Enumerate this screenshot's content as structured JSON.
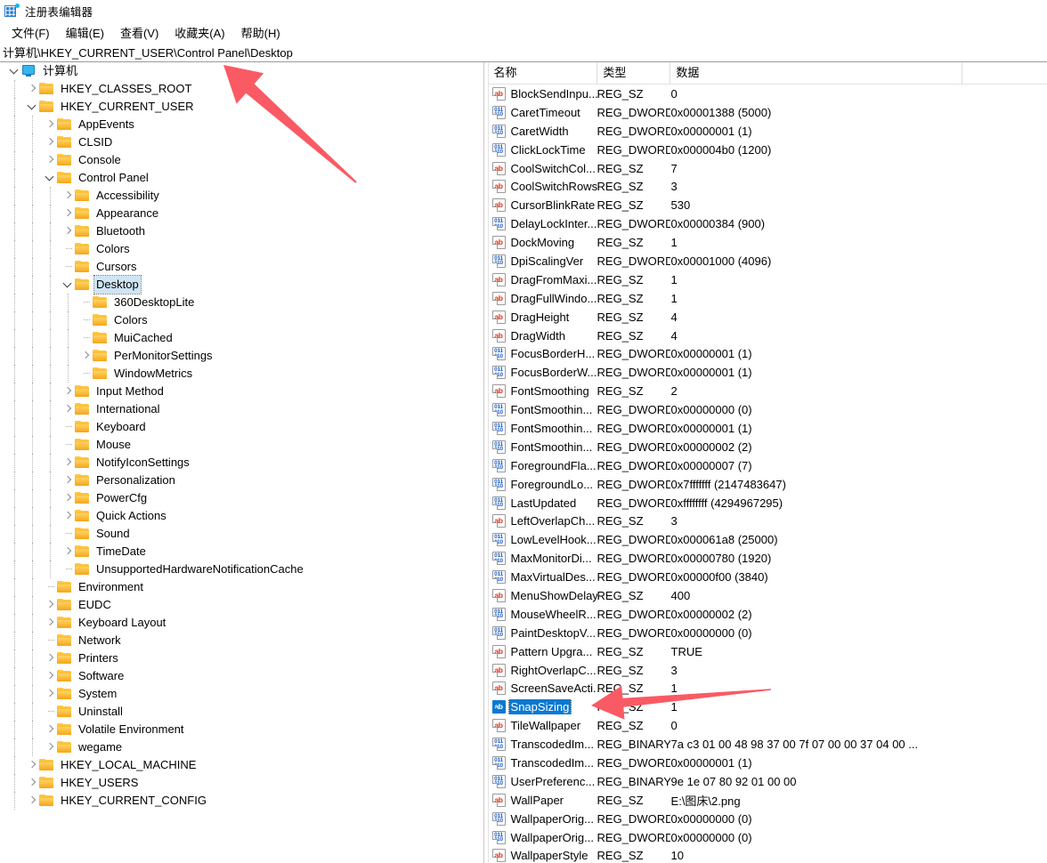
{
  "window": {
    "title": "注册表编辑器",
    "icon": "registry-editor-icon"
  },
  "menubar": {
    "items": [
      {
        "label": "文件(F)",
        "name": "menu-file"
      },
      {
        "label": "编辑(E)",
        "name": "menu-edit"
      },
      {
        "label": "查看(V)",
        "name": "menu-view"
      },
      {
        "label": "收藏夹(A)",
        "name": "menu-favorites"
      },
      {
        "label": "帮助(H)",
        "name": "menu-help"
      }
    ]
  },
  "addressbar": {
    "path": "计算机\\HKEY_CURRENT_USER\\Control Panel\\Desktop"
  },
  "tree": {
    "nodes": [
      {
        "label": "计算机",
        "indent": 0,
        "state": "expanded",
        "icon": "computer-icon"
      },
      {
        "label": "HKEY_CLASSES_ROOT",
        "indent": 1,
        "state": "collapsed",
        "icon": "folder-icon"
      },
      {
        "label": "HKEY_CURRENT_USER",
        "indent": 1,
        "state": "expanded",
        "icon": "folder-icon"
      },
      {
        "label": "AppEvents",
        "indent": 2,
        "state": "collapsed",
        "icon": "folder-icon"
      },
      {
        "label": "CLSID",
        "indent": 2,
        "state": "collapsed",
        "icon": "folder-icon"
      },
      {
        "label": "Console",
        "indent": 2,
        "state": "collapsed",
        "icon": "folder-icon"
      },
      {
        "label": "Control Panel",
        "indent": 2,
        "state": "expanded",
        "icon": "folder-icon"
      },
      {
        "label": "Accessibility",
        "indent": 3,
        "state": "collapsed",
        "icon": "folder-icon"
      },
      {
        "label": "Appearance",
        "indent": 3,
        "state": "collapsed",
        "icon": "folder-icon"
      },
      {
        "label": "Bluetooth",
        "indent": 3,
        "state": "collapsed",
        "icon": "folder-icon"
      },
      {
        "label": "Colors",
        "indent": 3,
        "state": "leaf",
        "icon": "folder-icon"
      },
      {
        "label": "Cursors",
        "indent": 3,
        "state": "leaf",
        "icon": "folder-icon"
      },
      {
        "label": "Desktop",
        "indent": 3,
        "state": "expanded",
        "icon": "folder-icon",
        "selected": true
      },
      {
        "label": "360DesktopLite",
        "indent": 4,
        "state": "leaf",
        "icon": "folder-icon"
      },
      {
        "label": "Colors",
        "indent": 4,
        "state": "leaf",
        "icon": "folder-icon"
      },
      {
        "label": "MuiCached",
        "indent": 4,
        "state": "leaf",
        "icon": "folder-icon"
      },
      {
        "label": "PerMonitorSettings",
        "indent": 4,
        "state": "collapsed",
        "icon": "folder-icon"
      },
      {
        "label": "WindowMetrics",
        "indent": 4,
        "state": "leaf",
        "icon": "folder-icon"
      },
      {
        "label": "Input Method",
        "indent": 3,
        "state": "collapsed",
        "icon": "folder-icon"
      },
      {
        "label": "International",
        "indent": 3,
        "state": "collapsed",
        "icon": "folder-icon"
      },
      {
        "label": "Keyboard",
        "indent": 3,
        "state": "leaf",
        "icon": "folder-icon"
      },
      {
        "label": "Mouse",
        "indent": 3,
        "state": "leaf",
        "icon": "folder-icon"
      },
      {
        "label": "NotifyIconSettings",
        "indent": 3,
        "state": "collapsed",
        "icon": "folder-icon"
      },
      {
        "label": "Personalization",
        "indent": 3,
        "state": "collapsed",
        "icon": "folder-icon"
      },
      {
        "label": "PowerCfg",
        "indent": 3,
        "state": "collapsed",
        "icon": "folder-icon"
      },
      {
        "label": "Quick Actions",
        "indent": 3,
        "state": "collapsed",
        "icon": "folder-icon"
      },
      {
        "label": "Sound",
        "indent": 3,
        "state": "leaf",
        "icon": "folder-icon"
      },
      {
        "label": "TimeDate",
        "indent": 3,
        "state": "collapsed",
        "icon": "folder-icon"
      },
      {
        "label": "UnsupportedHardwareNotificationCache",
        "indent": 3,
        "state": "leaf",
        "icon": "folder-icon"
      },
      {
        "label": "Environment",
        "indent": 2,
        "state": "leaf",
        "icon": "folder-icon"
      },
      {
        "label": "EUDC",
        "indent": 2,
        "state": "collapsed",
        "icon": "folder-icon"
      },
      {
        "label": "Keyboard Layout",
        "indent": 2,
        "state": "collapsed",
        "icon": "folder-icon"
      },
      {
        "label": "Network",
        "indent": 2,
        "state": "leaf",
        "icon": "folder-icon"
      },
      {
        "label": "Printers",
        "indent": 2,
        "state": "collapsed",
        "icon": "folder-icon"
      },
      {
        "label": "Software",
        "indent": 2,
        "state": "collapsed",
        "icon": "folder-icon"
      },
      {
        "label": "System",
        "indent": 2,
        "state": "collapsed",
        "icon": "folder-icon"
      },
      {
        "label": "Uninstall",
        "indent": 2,
        "state": "leaf",
        "icon": "folder-icon"
      },
      {
        "label": "Volatile Environment",
        "indent": 2,
        "state": "collapsed",
        "icon": "folder-icon"
      },
      {
        "label": "wegame",
        "indent": 2,
        "state": "collapsed",
        "icon": "folder-icon"
      },
      {
        "label": "HKEY_LOCAL_MACHINE",
        "indent": 1,
        "state": "collapsed",
        "icon": "folder-icon"
      },
      {
        "label": "HKEY_USERS",
        "indent": 1,
        "state": "collapsed",
        "icon": "folder-icon"
      },
      {
        "label": "HKEY_CURRENT_CONFIG",
        "indent": 1,
        "state": "collapsed",
        "icon": "folder-icon"
      }
    ]
  },
  "list": {
    "columns": [
      {
        "label": "名称",
        "name": "column-name"
      },
      {
        "label": "类型",
        "name": "column-type"
      },
      {
        "label": "数据",
        "name": "column-data"
      }
    ],
    "rows": [
      {
        "name": "BlockSendInpu...",
        "type": "REG_SZ",
        "data": "0",
        "icon": "string-value-icon"
      },
      {
        "name": "CaretTimeout",
        "type": "REG_DWORD",
        "data": "0x00001388 (5000)",
        "icon": "binary-value-icon"
      },
      {
        "name": "CaretWidth",
        "type": "REG_DWORD",
        "data": "0x00000001 (1)",
        "icon": "binary-value-icon"
      },
      {
        "name": "ClickLockTime",
        "type": "REG_DWORD",
        "data": "0x000004b0 (1200)",
        "icon": "binary-value-icon"
      },
      {
        "name": "CoolSwitchCol...",
        "type": "REG_SZ",
        "data": "7",
        "icon": "string-value-icon"
      },
      {
        "name": "CoolSwitchRows",
        "type": "REG_SZ",
        "data": "3",
        "icon": "string-value-icon"
      },
      {
        "name": "CursorBlinkRate",
        "type": "REG_SZ",
        "data": "530",
        "icon": "string-value-icon"
      },
      {
        "name": "DelayLockInter...",
        "type": "REG_DWORD",
        "data": "0x00000384 (900)",
        "icon": "binary-value-icon"
      },
      {
        "name": "DockMoving",
        "type": "REG_SZ",
        "data": "1",
        "icon": "string-value-icon"
      },
      {
        "name": "DpiScalingVer",
        "type": "REG_DWORD",
        "data": "0x00001000 (4096)",
        "icon": "binary-value-icon"
      },
      {
        "name": "DragFromMaxi...",
        "type": "REG_SZ",
        "data": "1",
        "icon": "string-value-icon"
      },
      {
        "name": "DragFullWindo...",
        "type": "REG_SZ",
        "data": "1",
        "icon": "string-value-icon"
      },
      {
        "name": "DragHeight",
        "type": "REG_SZ",
        "data": "4",
        "icon": "string-value-icon"
      },
      {
        "name": "DragWidth",
        "type": "REG_SZ",
        "data": "4",
        "icon": "string-value-icon"
      },
      {
        "name": "FocusBorderH...",
        "type": "REG_DWORD",
        "data": "0x00000001 (1)",
        "icon": "binary-value-icon"
      },
      {
        "name": "FocusBorderW...",
        "type": "REG_DWORD",
        "data": "0x00000001 (1)",
        "icon": "binary-value-icon"
      },
      {
        "name": "FontSmoothing",
        "type": "REG_SZ",
        "data": "2",
        "icon": "string-value-icon"
      },
      {
        "name": "FontSmoothin...",
        "type": "REG_DWORD",
        "data": "0x00000000 (0)",
        "icon": "binary-value-icon"
      },
      {
        "name": "FontSmoothin...",
        "type": "REG_DWORD",
        "data": "0x00000001 (1)",
        "icon": "binary-value-icon"
      },
      {
        "name": "FontSmoothin...",
        "type": "REG_DWORD",
        "data": "0x00000002 (2)",
        "icon": "binary-value-icon"
      },
      {
        "name": "ForegroundFla...",
        "type": "REG_DWORD",
        "data": "0x00000007 (7)",
        "icon": "binary-value-icon"
      },
      {
        "name": "ForegroundLo...",
        "type": "REG_DWORD",
        "data": "0x7fffffff (2147483647)",
        "icon": "binary-value-icon"
      },
      {
        "name": "LastUpdated",
        "type": "REG_DWORD",
        "data": "0xffffffff (4294967295)",
        "icon": "binary-value-icon"
      },
      {
        "name": "LeftOverlapCh...",
        "type": "REG_SZ",
        "data": "3",
        "icon": "string-value-icon"
      },
      {
        "name": "LowLevelHook...",
        "type": "REG_DWORD",
        "data": "0x000061a8 (25000)",
        "icon": "binary-value-icon"
      },
      {
        "name": "MaxMonitorDi...",
        "type": "REG_DWORD",
        "data": "0x00000780 (1920)",
        "icon": "binary-value-icon"
      },
      {
        "name": "MaxVirtualDes...",
        "type": "REG_DWORD",
        "data": "0x00000f00 (3840)",
        "icon": "binary-value-icon"
      },
      {
        "name": "MenuShowDelay",
        "type": "REG_SZ",
        "data": "400",
        "icon": "string-value-icon"
      },
      {
        "name": "MouseWheelR...",
        "type": "REG_DWORD",
        "data": "0x00000002 (2)",
        "icon": "binary-value-icon"
      },
      {
        "name": "PaintDesktopV...",
        "type": "REG_DWORD",
        "data": "0x00000000 (0)",
        "icon": "binary-value-icon"
      },
      {
        "name": "Pattern Upgra...",
        "type": "REG_SZ",
        "data": "TRUE",
        "icon": "string-value-icon"
      },
      {
        "name": "RightOverlapC...",
        "type": "REG_SZ",
        "data": "3",
        "icon": "string-value-icon"
      },
      {
        "name": "ScreenSaveActi...",
        "type": "REG_SZ",
        "data": "1",
        "icon": "string-value-icon"
      },
      {
        "name": "SnapSizing",
        "type": "REG_SZ",
        "data": "1",
        "icon": "string-value-icon",
        "selected": true
      },
      {
        "name": "TileWallpaper",
        "type": "REG_SZ",
        "data": "0",
        "icon": "string-value-icon"
      },
      {
        "name": "TranscodedIm...",
        "type": "REG_BINARY",
        "data": "7a c3 01 00 48 98 37 00 7f 07 00 00 37 04 00 ...",
        "icon": "binary-value-icon"
      },
      {
        "name": "TranscodedIm...",
        "type": "REG_DWORD",
        "data": "0x00000001 (1)",
        "icon": "binary-value-icon"
      },
      {
        "name": "UserPreferenc...",
        "type": "REG_BINARY",
        "data": "9e 1e 07 80 92 01 00 00",
        "icon": "binary-value-icon"
      },
      {
        "name": "WallPaper",
        "type": "REG_SZ",
        "data": "E:\\图床\\2.png",
        "icon": "string-value-icon"
      },
      {
        "name": "WallpaperOrig...",
        "type": "REG_DWORD",
        "data": "0x00000000 (0)",
        "icon": "binary-value-icon"
      },
      {
        "name": "WallpaperOrig...",
        "type": "REG_DWORD",
        "data": "0x00000000 (0)",
        "icon": "binary-value-icon"
      },
      {
        "name": "WallpaperStyle",
        "type": "REG_SZ",
        "data": "10",
        "icon": "string-value-icon"
      }
    ]
  },
  "annotations": {
    "arrow_color": "#fa5a64",
    "arrows": [
      {
        "name": "annotation-arrow-tree",
        "direction": "up-left"
      },
      {
        "name": "annotation-arrow-list",
        "direction": "left"
      }
    ]
  },
  "icons": {
    "string_glyph": "ab",
    "binary_glyph_top": "011",
    "binary_glyph_bottom": "110"
  }
}
